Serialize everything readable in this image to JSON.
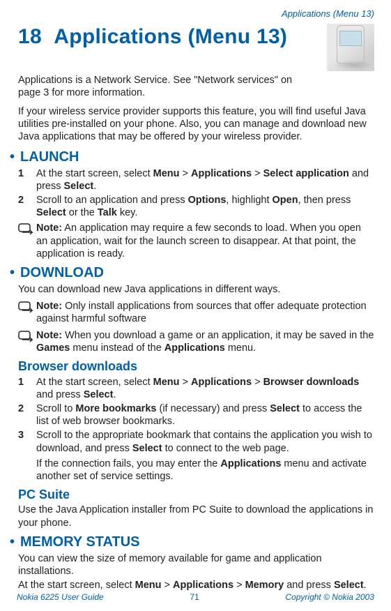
{
  "running_head": "Applications (Menu 13)",
  "chapter": {
    "number": "18",
    "title": "Applications (Menu 13)"
  },
  "intro1": "Applications is a Network Service. See \"Network services\" on page 3 for more information.",
  "intro2": "If your wireless service provider supports this feature, you will find useful Java utilities pre-installed on your phone. Also, you can manage and download new Java applications that may be offered by your wireless provider.",
  "launch": {
    "title": "LAUNCH",
    "steps": [
      {
        "n": "1",
        "pre": "At the start screen, select ",
        "b1": "Menu",
        "sep1": " > ",
        "b2": "Applications",
        "sep2": " > ",
        "b3": "Select application",
        "mid": " and press ",
        "b4": "Select",
        "post": "."
      },
      {
        "n": "2",
        "pre": "Scroll to an application and press ",
        "b1": "Options",
        "sep1": ", highlight ",
        "b2": "Open",
        "sep2": ", then press ",
        "b3": "Select",
        "mid": " or the ",
        "b4": "Talk",
        "post": " key."
      }
    ],
    "note": {
      "label": "Note:",
      "text": " An application may require a few seconds to load. When you open an application, wait for the launch screen to disappear. At that point, the application is ready."
    }
  },
  "download": {
    "title": "DOWNLOAD",
    "intro": "You can download new Java applications in different ways.",
    "note1": {
      "label": "Note:",
      "text": " Only install applications from sources that offer adequate protection against harmful software"
    },
    "note2": {
      "label": "Note:",
      "pre": " When you download a game or an application, it may be saved in the ",
      "b1": "Games",
      "mid": " menu instead of the ",
      "b2": "Applications",
      "post": " menu."
    },
    "browser": {
      "title": "Browser downloads",
      "steps": [
        {
          "n": "1",
          "pre": "At the start screen, select ",
          "b1": "Menu",
          "sep1": " > ",
          "b2": "Applications",
          "sep2": " > ",
          "b3": "Browser downloads",
          "mid": " and press ",
          "b4": "Select",
          "post": "."
        },
        {
          "n": "2",
          "pre": "Scroll to ",
          "b1": "More bookmarks",
          "mid": " (if necessary) and press ",
          "b2": "Select",
          "post": " to access the list of web browser bookmarks."
        },
        {
          "n": "3",
          "pre": "Scroll to the appropriate bookmark that contains the application you wish to download, and press ",
          "b1": "Select",
          "post": " to connect to the web page."
        }
      ],
      "tail": {
        "pre": "If the connection fails, you may enter the ",
        "b1": "Applications",
        "post": " menu and activate another set of service settings."
      }
    },
    "pcsuite": {
      "title": "PC Suite",
      "text": "Use the Java Application installer from PC Suite to download the applications in your phone."
    }
  },
  "memory": {
    "title": "MEMORY STATUS",
    "line1": "You can view the size of memory available for game and application installations.",
    "line2": {
      "pre": "At the start screen, select ",
      "b1": "Menu",
      "sep1": " > ",
      "b2": "Applications",
      "sep2": " > ",
      "b3": "Memory",
      "mid": " and press ",
      "b4": "Select",
      "post": "."
    }
  },
  "footer": {
    "left": "Nokia 6225 User Guide",
    "page": "71",
    "right": "Copyright © Nokia 2003"
  }
}
